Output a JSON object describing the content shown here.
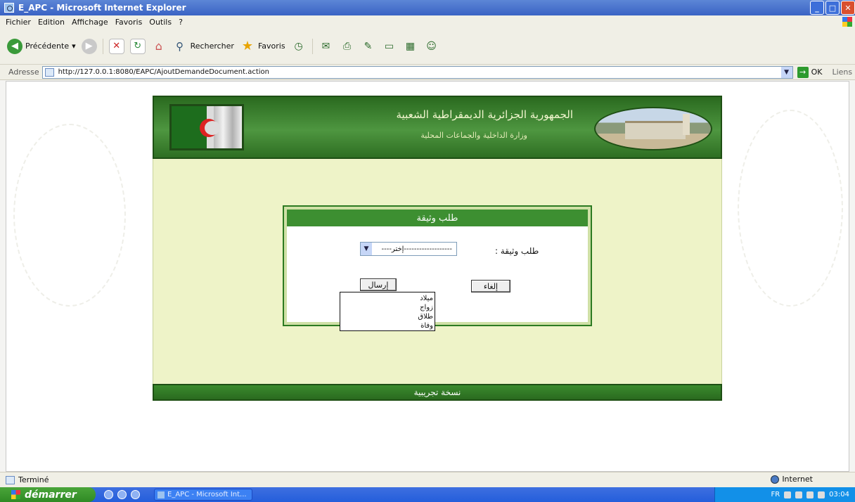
{
  "window": {
    "title": "E_APC - Microsoft Internet Explorer"
  },
  "menu": [
    "Fichier",
    "Edition",
    "Affichage",
    "Favoris",
    "Outils",
    "?"
  ],
  "toolbar": {
    "back_label": "Précédente",
    "search_label": "Rechercher",
    "favorites_label": "Favoris"
  },
  "address": {
    "label": "Adresse",
    "url": "http://127.0.0.1:8080/EAPC/AjoutDemandeDocument.action",
    "go_label": "OK",
    "links_label": "Liens"
  },
  "banner": {
    "line1": "الجمهورية الجزائرية الديمقراطية الشعبية",
    "line2": "وزارة الداخلية والجماعات المحلية"
  },
  "form": {
    "heading": "طلب وثيقة",
    "label": "طلب وثيقة :",
    "select_value": "-------------------إختر----",
    "options": [
      "ميلاد",
      "زواج",
      "طلاق",
      "وفاة"
    ],
    "send_label": "إرسال",
    "cancel_label": "إلغاء"
  },
  "footer": {
    "text": "نسخة تجريبية"
  },
  "status": {
    "text": "Terminé",
    "zone": "Internet"
  },
  "taskbar": {
    "start_label": "démarrer",
    "task_label": "E_APC - Microsoft Int...",
    "clock": "03:04",
    "lang": "FR"
  }
}
